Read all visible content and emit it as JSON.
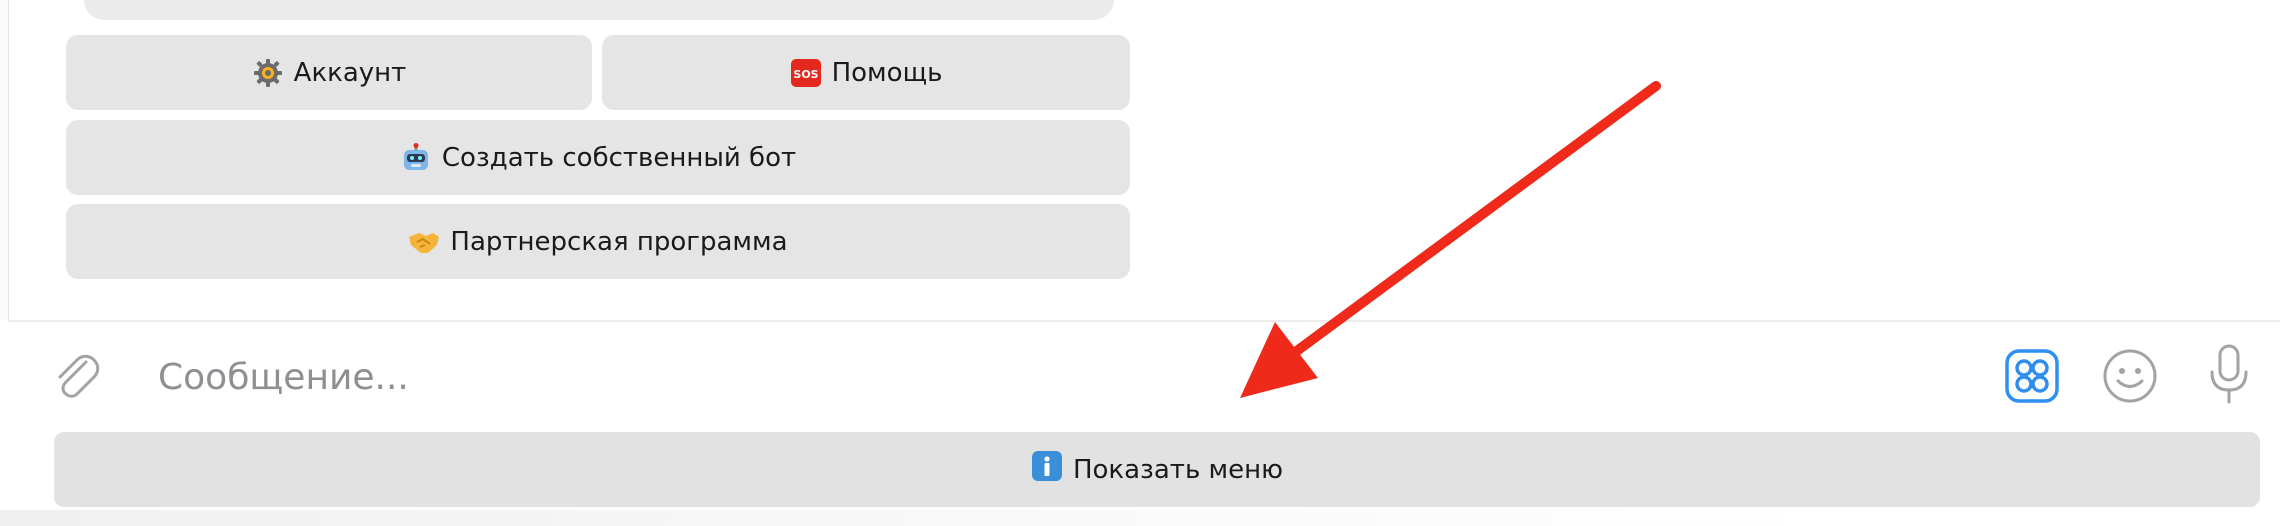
{
  "keyboard": {
    "account_label": "Аккаунт",
    "account_icon": "gear-icon",
    "help_label": "Помощь",
    "help_icon": "sos-icon",
    "create_bot_label": "Создать собственный бот",
    "create_bot_icon": "robot-icon",
    "partner_label": "Партнерская программа",
    "partner_icon": "handshake-icon"
  },
  "composer": {
    "placeholder": "Сообщение...",
    "attach_icon": "paperclip-icon",
    "commands_icon": "bot-commands-icon",
    "emoji_icon": "smile-icon",
    "voice_icon": "microphone-icon"
  },
  "menu_toggle": {
    "label": "Показать меню",
    "icon": "info-icon"
  },
  "colors": {
    "button_bg": "#e5e5e5",
    "accent": "#2f8ef0",
    "annotation_arrow": "#f02a1a",
    "sos_red": "#e3281e"
  }
}
